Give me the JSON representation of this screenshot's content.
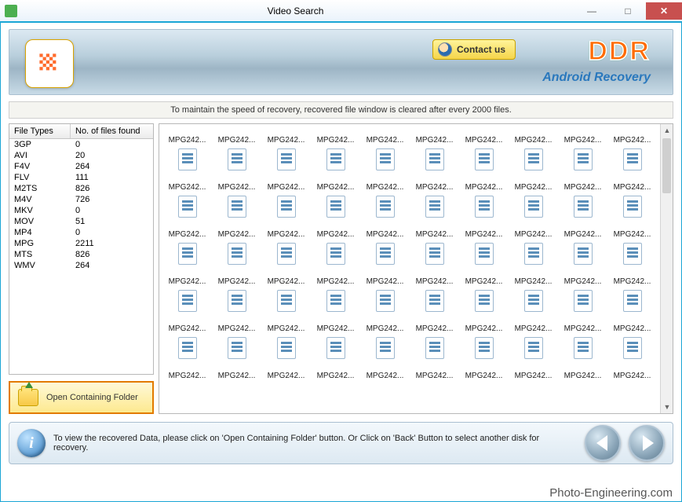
{
  "window": {
    "title": "Video Search",
    "minimize": "—",
    "maximize": "□",
    "close": "✕"
  },
  "header": {
    "contact_label": "Contact us",
    "brand": "DDR",
    "sub_brand": "Android Recovery"
  },
  "message_strip": "To maintain the speed of recovery, recovered file window is cleared after every 2000 files.",
  "file_table": {
    "col_type": "File Types",
    "col_count": "No. of files found",
    "rows": [
      {
        "type": "3GP",
        "count": "0"
      },
      {
        "type": "AVI",
        "count": "20"
      },
      {
        "type": "F4V",
        "count": "264"
      },
      {
        "type": "FLV",
        "count": "111"
      },
      {
        "type": "M2TS",
        "count": "826"
      },
      {
        "type": "M4V",
        "count": "726"
      },
      {
        "type": "MKV",
        "count": "0"
      },
      {
        "type": "MOV",
        "count": "51"
      },
      {
        "type": "MP4",
        "count": "0"
      },
      {
        "type": "MPG",
        "count": "2211"
      },
      {
        "type": "MTS",
        "count": "826"
      },
      {
        "type": "WMV",
        "count": "264"
      }
    ]
  },
  "open_folder_label": "Open Containing Folder",
  "grid_item_label": "MPG242...",
  "footer": {
    "text": "To view the recovered Data, please click on 'Open Containing Folder' button. Or Click on 'Back' Button to select another disk for recovery."
  },
  "watermark": "Photo-Engineering.com"
}
